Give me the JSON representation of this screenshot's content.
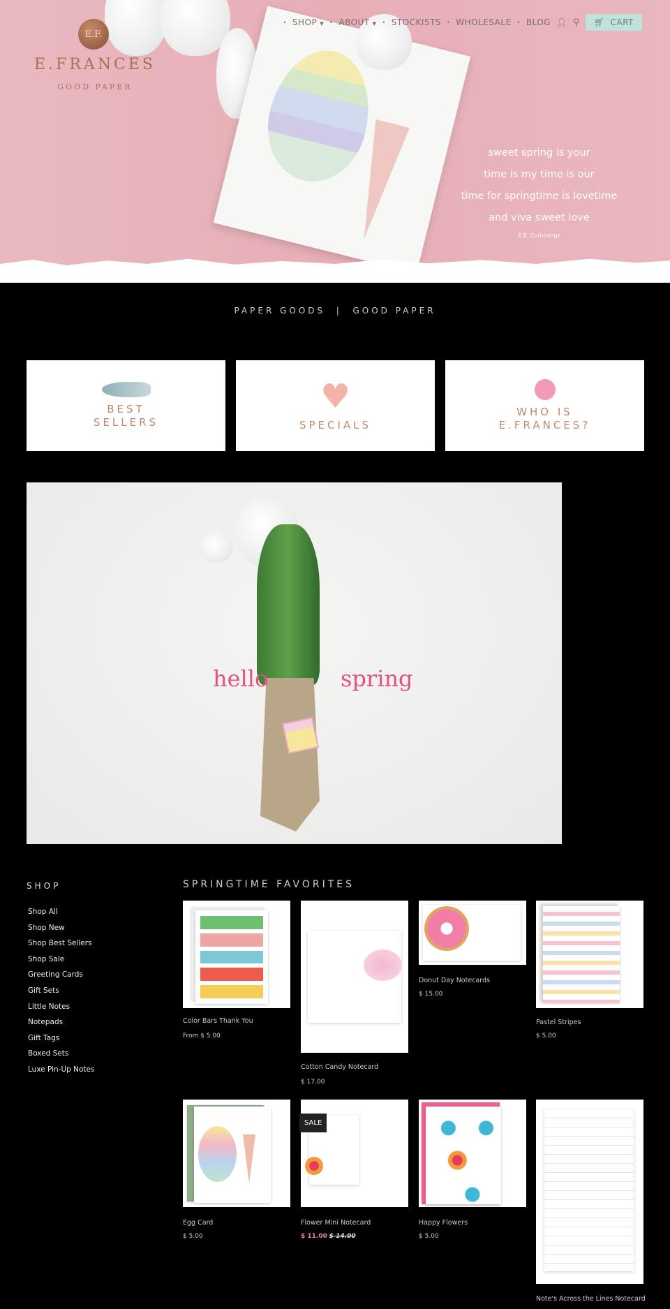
{
  "header": {
    "logo_monogram": "E.F.",
    "logo_name": "E.FRANCES",
    "logo_tagline": "GOOD PAPER",
    "nav": [
      {
        "label": "SHOP",
        "dropdown": true
      },
      {
        "label": "ABOUT",
        "dropdown": true
      },
      {
        "label": "STOCKISTS"
      },
      {
        "label": "WHOLESALE"
      },
      {
        "label": "BLOG"
      }
    ],
    "account_icon": "user-icon",
    "search_icon": "search-icon",
    "cart_label": "CART",
    "cart_icon": "cart-icon"
  },
  "hero": {
    "poem": [
      "sweet spring is your",
      "time is my time is our",
      "time for springtime is lovetime",
      "and viva sweet love"
    ],
    "attribution": "E.E. Cummings"
  },
  "tagline": "PAPER GOODS  |  GOOD PAPER",
  "promos": [
    {
      "label": "BEST\nSELLERS",
      "icon": "whale-icon"
    },
    {
      "label": "SPECIALS",
      "icon": "heart-icon"
    },
    {
      "label": "WHO IS\nE.FRANCES?",
      "icon": "pink-dot-icon"
    }
  ],
  "feature": {
    "left": "hello",
    "right": "spring"
  },
  "sidebar": {
    "heading": "SHOP",
    "items": [
      "Shop All",
      "Shop New",
      "Shop Best Sellers",
      "Shop Sale",
      "Greeting Cards",
      "Gift Sets",
      "Little Notes",
      "Notepads",
      "Gift Tags",
      "Boxed Sets",
      "Luxe Pin-Up Notes"
    ]
  },
  "products": {
    "heading": "SPRINGTIME FAVORITES",
    "items": [
      {
        "name": "Color Bars Thank You",
        "price": "From $ 5.00"
      },
      {
        "name": "Cotton Candy Notecard",
        "price": "$ 17.00"
      },
      {
        "name": "Donut Day Notecards",
        "price": "$ 15.00"
      },
      {
        "name": "Pastel Stripes",
        "price": "$ 5.00"
      },
      {
        "name": "Egg Card",
        "price": "$ 5.00"
      },
      {
        "name": "Flower Mini Notecard",
        "price": "$ 11.00",
        "old_price": "$ 14.00",
        "badge": "SALE"
      },
      {
        "name": "Happy Flowers",
        "price": "$ 5.00"
      },
      {
        "name": "Note's Across the Lines Notecard"
      }
    ]
  },
  "colors": {
    "hero_pink": "#e8b4bc",
    "cart_bg": "#bfe3da",
    "accent_copper": "#c08a6e",
    "sale_pink": "#e68aa5"
  }
}
